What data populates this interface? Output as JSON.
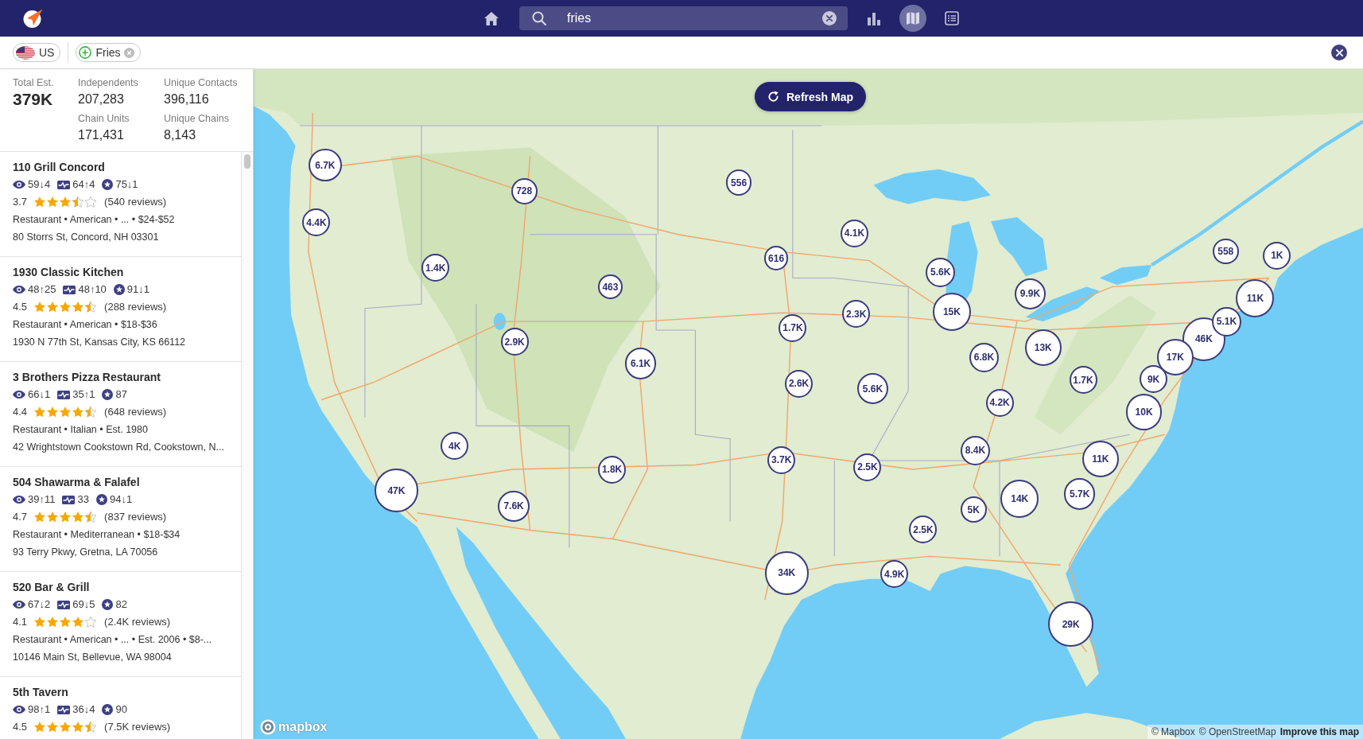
{
  "app_bar": {
    "search": {
      "value": "fries"
    },
    "views": [
      {
        "kind": "chart",
        "selected": false
      },
      {
        "kind": "map",
        "selected": true
      },
      {
        "kind": "list",
        "selected": false
      }
    ]
  },
  "filter_bar": {
    "chips": [
      {
        "kind": "region",
        "label": "US"
      },
      {
        "kind": "term",
        "label": "Fries"
      }
    ]
  },
  "summary": {
    "total": {
      "label": "Total Est.",
      "value": "379K"
    },
    "stats": [
      {
        "label": "Independents",
        "value": "207,283"
      },
      {
        "label": "Unique Contacts",
        "value": "396,116"
      },
      {
        "label": "Chain Units",
        "value": "171,431"
      },
      {
        "label": "Unique Chains",
        "value": "8,143"
      }
    ]
  },
  "listings": [
    {
      "name": "110 Grill Concord",
      "metrics": [
        {
          "kind": "views",
          "text": "59↓4"
        },
        {
          "kind": "activity",
          "text": "64↑4"
        },
        {
          "kind": "score",
          "text": "75↓1"
        }
      ],
      "rating": "3.7",
      "stars": 3.5,
      "reviews": "(540 reviews)",
      "category": "Restaurant • American • ... • $24-$52",
      "address": "80 Storrs St, Concord, NH 03301"
    },
    {
      "name": "1930 Classic Kitchen",
      "metrics": [
        {
          "kind": "views",
          "text": "48↑25"
        },
        {
          "kind": "activity",
          "text": "48↑10"
        },
        {
          "kind": "score",
          "text": "91↓1"
        }
      ],
      "rating": "4.5",
      "stars": 4.5,
      "reviews": "(288 reviews)",
      "category": "Restaurant • American • $18-$36",
      "address": "1930 N 77th St, Kansas City, KS 66112"
    },
    {
      "name": "3 Brothers Pizza Restaurant",
      "metrics": [
        {
          "kind": "views",
          "text": "66↓1"
        },
        {
          "kind": "activity",
          "text": "35↑1"
        },
        {
          "kind": "score",
          "text": "87"
        }
      ],
      "rating": "4.4",
      "stars": 4.5,
      "reviews": "(648 reviews)",
      "category": "Restaurant • Italian • Est. 1980",
      "address": "42 Wrightstown Cookstown Rd, Cookstown, N..."
    },
    {
      "name": "504 Shawarma & Falafel",
      "metrics": [
        {
          "kind": "views",
          "text": "39↑11"
        },
        {
          "kind": "activity",
          "text": "33"
        },
        {
          "kind": "score",
          "text": "94↓1"
        }
      ],
      "rating": "4.7",
      "stars": 4.5,
      "reviews": "(837 reviews)",
      "category": "Restaurant • Mediterranean • $18-$34",
      "address": "93 Terry Pkwy, Gretna, LA 70056"
    },
    {
      "name": "520 Bar & Grill",
      "metrics": [
        {
          "kind": "views",
          "text": "67↓2"
        },
        {
          "kind": "activity",
          "text": "69↓5"
        },
        {
          "kind": "score",
          "text": "82"
        }
      ],
      "rating": "4.1",
      "stars": 4,
      "reviews": "(2.4K reviews)",
      "category": "Restaurant • American • ... • Est. 2006 • $8-...",
      "address": "10146 Main St, Bellevue, WA 98004"
    },
    {
      "name": "5th Tavern",
      "metrics": [
        {
          "kind": "views",
          "text": "98↑1"
        },
        {
          "kind": "activity",
          "text": "36↓4"
        },
        {
          "kind": "score",
          "text": "90"
        }
      ],
      "rating": "4.5",
      "stars": 4.5,
      "reviews": "(7.5K reviews)"
    }
  ],
  "map": {
    "refresh_button": "Refresh Map",
    "clusters": [
      "6.7K",
      "4.4K",
      "728",
      "556",
      "1.4K",
      "463",
      "616",
      "4.1K",
      "5.6K",
      "15K",
      "9.9K",
      "558",
      "1K",
      "11K",
      "46K",
      "5.1K",
      "17K",
      "9K",
      "10K",
      "13K",
      "6.8K",
      "1.7K",
      "4.2K",
      "2.3K",
      "1.7K",
      "2.9K",
      "6.1K",
      "2.6K",
      "5.6K",
      "4K",
      "47K",
      "7.6K",
      "1.8K",
      "3.7K",
      "2.5K",
      "8.4K",
      "11K",
      "5K",
      "14K",
      "5.7K",
      "2.5K",
      "34K",
      "4.9K",
      "29K"
    ],
    "logo": "mapbox",
    "attribution": [
      {
        "kind": "credit",
        "text": "© Mapbox"
      },
      {
        "kind": "credit",
        "text": "© OpenStreetMap"
      },
      {
        "kind": "feedback",
        "text": "Improve this map"
      }
    ]
  }
}
